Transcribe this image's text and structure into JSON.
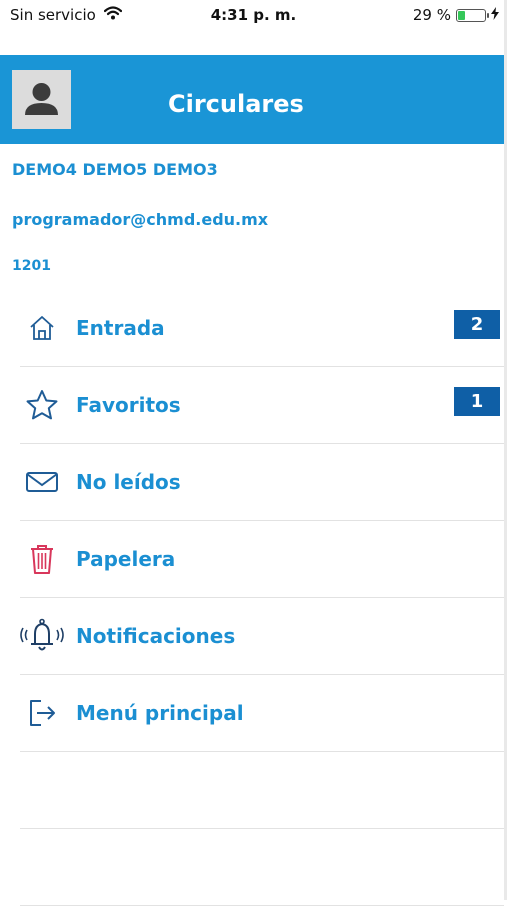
{
  "status_bar": {
    "carrier": "Sin servicio",
    "time": "4:31 p. m.",
    "battery_percent": "29 %",
    "battery_level": 0.29
  },
  "header": {
    "title": "Circulares",
    "color": "#1a95d6"
  },
  "user": {
    "name": "DEMO4 DEMO5 DEMO3",
    "email": "programador@chmd.edu.mx",
    "id": "1201"
  },
  "menu": {
    "items": [
      {
        "label": "Entrada",
        "icon": "home-icon",
        "badge": "2"
      },
      {
        "label": "Favoritos",
        "icon": "star-icon",
        "badge": "1"
      },
      {
        "label": "No leídos",
        "icon": "envelope-icon"
      },
      {
        "label": "Papelera",
        "icon": "trash-icon"
      },
      {
        "label": "Notificaciones",
        "icon": "bell-icon"
      },
      {
        "label": "Menú principal",
        "icon": "logout-icon"
      }
    ]
  },
  "colors": {
    "accent": "#1b8fd2",
    "badge": "#0f5fa6",
    "trash": "#d8375b"
  }
}
